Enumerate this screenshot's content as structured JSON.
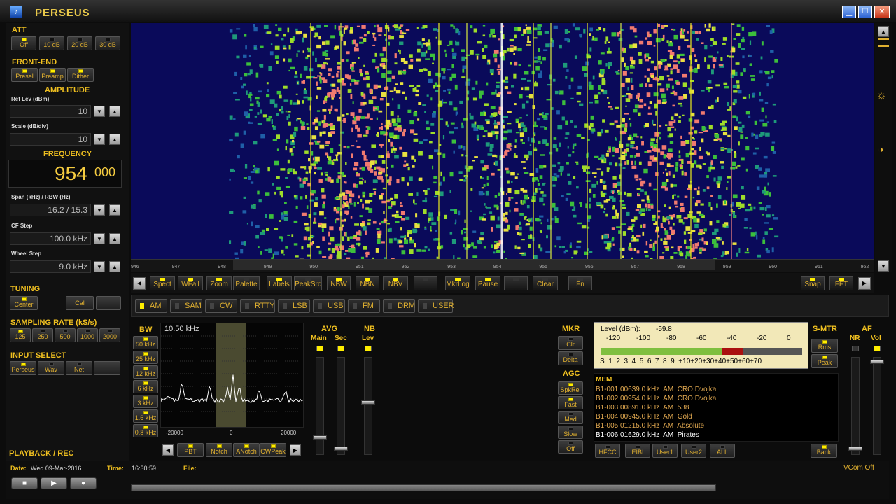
{
  "window": {
    "title": "PERSEUS",
    "icon": "perseus-logo-icon"
  },
  "left": {
    "att": {
      "title": "ATT",
      "buttons": [
        "Off",
        "10 dB",
        "20 dB",
        "30 dB"
      ]
    },
    "frontend": {
      "title": "FRONT-END",
      "buttons": [
        "Presel",
        "Preamp",
        "Dither"
      ]
    },
    "amplitude": {
      "title": "AMPLITUDE",
      "ref_label": "Ref Lev (dBm)",
      "ref_value": "10",
      "scale_label": "Scale (dB/div)",
      "scale_value": "10"
    },
    "frequency": {
      "title": "FREQUENCY",
      "main": "954",
      "sub": "000"
    },
    "span": {
      "label": "Span (kHz) / RBW (Hz)",
      "value": "16.2 / 15.3"
    },
    "cfstep": {
      "label": "CF Step",
      "value": "100.0 kHz"
    },
    "wheel": {
      "label": "Wheel Step",
      "value": "9.0 kHz"
    },
    "tuning": {
      "title": "TUNING",
      "buttons": [
        "Center",
        "Cal"
      ]
    },
    "sampling": {
      "title": "SAMPLING RATE (kS/s)",
      "buttons": [
        "125",
        "250",
        "500",
        "1000",
        "2000"
      ]
    },
    "input": {
      "title": "INPUT SELECT",
      "buttons": [
        "Perseus",
        "Wav",
        "Net"
      ]
    },
    "playback": {
      "title": "PLAYBACK / REC"
    }
  },
  "status": {
    "date_label": "Date:",
    "date": "Wed 09-Mar-2016",
    "time_label": "Time:",
    "time": "16:30:59",
    "file_label": "File:",
    "vcom": "VCom Off"
  },
  "freq_ticks": [
    "946",
    "947",
    "948",
    "949",
    "950",
    "951",
    "952",
    "953",
    "954",
    "955",
    "956",
    "957",
    "958",
    "959",
    "960",
    "961",
    "962"
  ],
  "toolbar": [
    "Spect",
    "WFall",
    "Zoom",
    "Palette",
    "Labels",
    "PeakSrc",
    "NBW",
    "NBN",
    "NBV",
    "",
    "MkrLog",
    "Pause",
    "",
    "Clear",
    "Fn",
    "Snap",
    "FFT"
  ],
  "modes": [
    "AM",
    "SAM",
    "CW",
    "RTTY",
    "LSB",
    "USB",
    "FM",
    "DRM",
    "USER"
  ],
  "bw": {
    "title": "BW",
    "value": "10.50 kHz",
    "buttons": [
      "50 kHz",
      "25 kHz",
      "12 kHz",
      "6 kHz",
      "3 kHz",
      "1.6 kHz",
      "0.8 kHz"
    ],
    "axis": [
      "-20000",
      "0",
      "20000"
    ]
  },
  "avg": {
    "title": "AVG",
    "main": "Main",
    "sec": "Sec"
  },
  "nb": {
    "title": "NB",
    "lev": "Lev"
  },
  "filter_buttons": [
    "PBT",
    "Notch",
    "ANotch",
    "CWPeak"
  ],
  "mkr": {
    "title": "MKR",
    "buttons": [
      "Clr",
      "Delta"
    ]
  },
  "agc": {
    "title": "AGC",
    "buttons": [
      "SpkRej",
      "Fast",
      "Med",
      "Slow",
      "Off"
    ]
  },
  "smeter": {
    "level_label": "Level (dBm):",
    "level": "-59.8",
    "dbm_scale": [
      "-120",
      "-100",
      "-80",
      "-60",
      "-40",
      "-20",
      "0"
    ],
    "s_scale": "S  1  2  3  4  5  6  7  8  9  +10+20+30+40+50+60+70",
    "fill_fraction": 0.71
  },
  "smtr": {
    "title": "S-MTR",
    "buttons": [
      "Rms",
      "Peak"
    ]
  },
  "af": {
    "title": "AF",
    "nr": "NR",
    "vol": "Vol"
  },
  "mem": {
    "title": "MEM",
    "rows": [
      "B1-001 00639.0 kHz  AM  CRO Dvojka",
      "B1-002 00954.0 kHz  AM  CRO Dvojka",
      "B1-003 00891.0 kHz  AM  538",
      "B1-004 00945.0 kHz  AM  Gold",
      "B1-005 01215.0 kHz  AM  Absolute",
      "B1-006 01629.0 kHz  AM  Pirates"
    ],
    "buttons": [
      "HFCC",
      "EIBI",
      "User1",
      "User2",
      "ALL",
      "Bank"
    ]
  }
}
